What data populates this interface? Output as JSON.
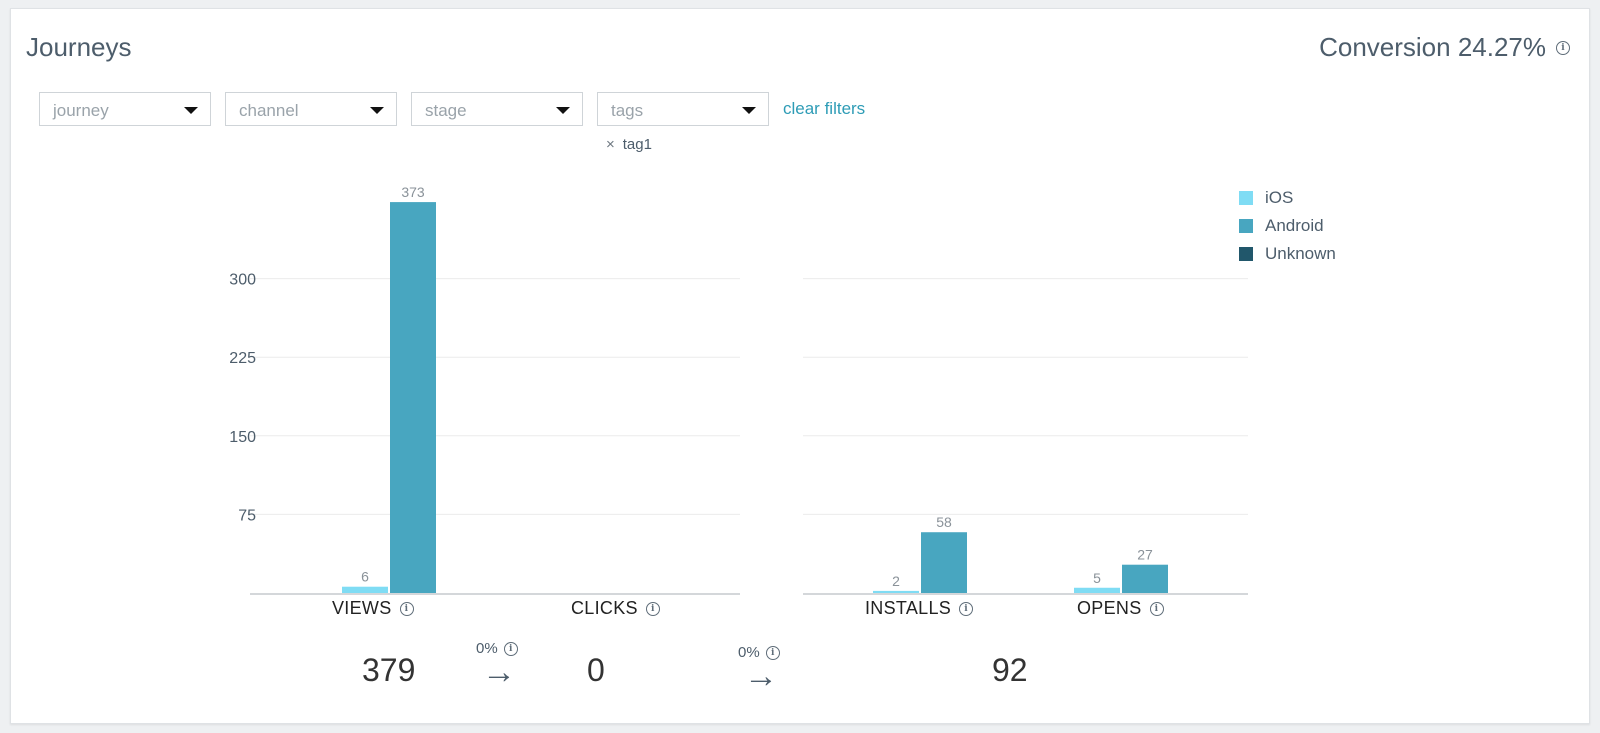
{
  "header": {
    "title": "Journeys",
    "conversion_label": "Conversion 24.27%"
  },
  "filters": {
    "journey_placeholder": "journey",
    "channel_placeholder": "channel",
    "stage_placeholder": "stage",
    "tags_placeholder": "tags",
    "clear_label": "clear filters",
    "selected_tag": "tag1"
  },
  "legend": [
    {
      "name": "iOS",
      "color": "#7fdcf4"
    },
    {
      "name": "Android",
      "color": "#48a6c0"
    },
    {
      "name": "Unknown",
      "color": "#21576b"
    }
  ],
  "stages": {
    "views": {
      "label": "VIEWS",
      "total": "379"
    },
    "clicks": {
      "label": "CLICKS",
      "total": "0"
    },
    "installs": {
      "label": "INSTALLS"
    },
    "opens": {
      "label": "OPENS"
    },
    "installs_opens_total": "92"
  },
  "flows": {
    "views_to_clicks": "0%",
    "clicks_to_installs": "0%"
  },
  "chart_data": {
    "type": "bar",
    "ylim": [
      0,
      375
    ],
    "yticks": [
      "75",
      "150",
      "225",
      "300"
    ],
    "panels": [
      {
        "categories": [
          "VIEWS",
          "CLICKS"
        ],
        "series": [
          {
            "name": "iOS",
            "values": [
              6,
              0
            ]
          },
          {
            "name": "Android",
            "values": [
              373,
              0
            ]
          },
          {
            "name": "Unknown",
            "values": [
              0,
              0
            ]
          }
        ]
      },
      {
        "categories": [
          "INSTALLS",
          "OPENS"
        ],
        "series": [
          {
            "name": "iOS",
            "values": [
              2,
              5
            ]
          },
          {
            "name": "Android",
            "values": [
              58,
              27
            ]
          },
          {
            "name": "Unknown",
            "values": [
              0,
              0
            ]
          }
        ]
      }
    ],
    "legend_position": "right",
    "grid": true
  }
}
